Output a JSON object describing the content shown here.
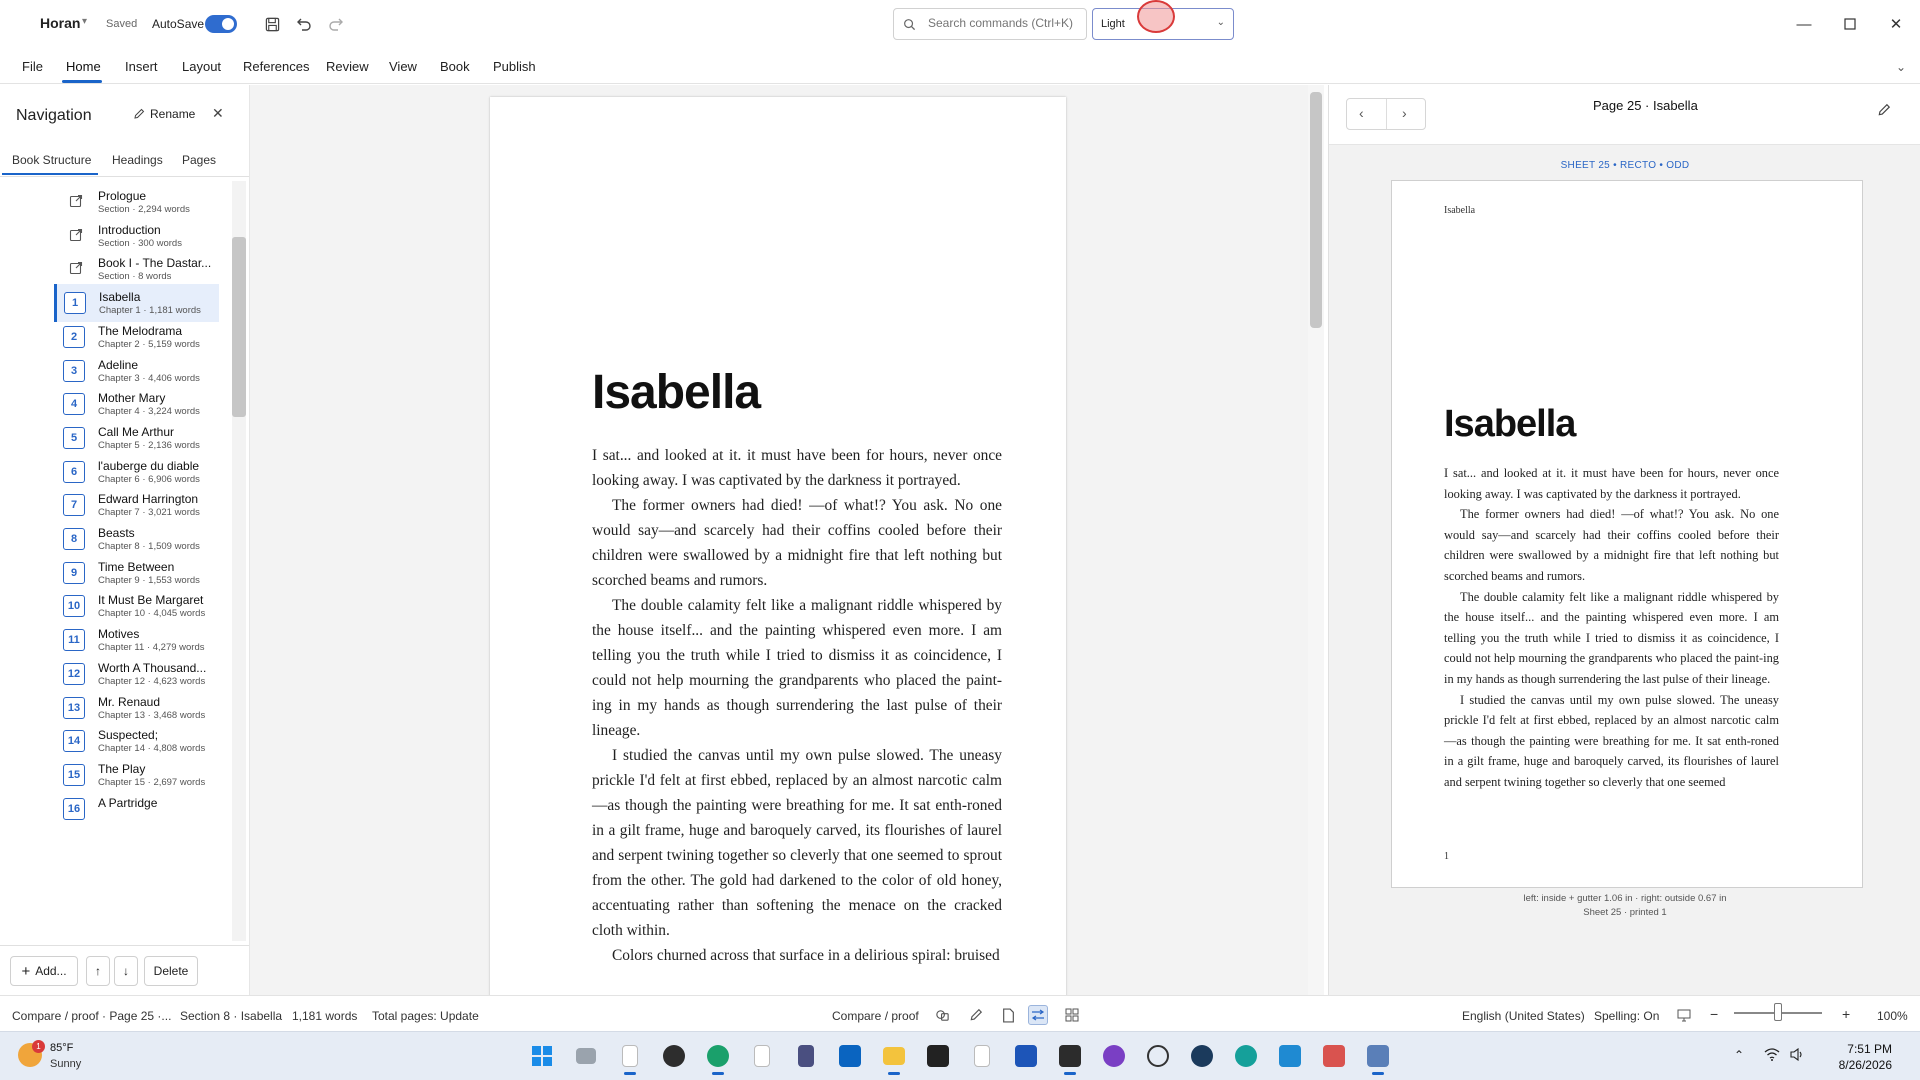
{
  "titlebar": {
    "doc_name": "Horan",
    "saved": "Saved",
    "autosave_label": "AutoSave",
    "search_placeholder": "Search commands (Ctrl+K)",
    "theme_value": "Light"
  },
  "ribbon": {
    "tabs": [
      "File",
      "Home",
      "Insert",
      "Layout",
      "References",
      "Review",
      "View",
      "Book",
      "Publish"
    ],
    "active_tab": "Home"
  },
  "nav": {
    "title": "Navigation",
    "rename": "Rename",
    "tabs": [
      "Book Structure",
      "Headings",
      "Pages"
    ],
    "items": [
      {
        "badge": "",
        "name": "Prologue",
        "meta": "Section · 2,294 words"
      },
      {
        "badge": "",
        "name": "Introduction",
        "meta": "Section · 300 words"
      },
      {
        "badge": "",
        "name": "Book I - The Dastar...",
        "meta": "Section · 8 words"
      },
      {
        "badge": "1",
        "name": "Isabella",
        "meta": "Chapter 1 · 1,181 words"
      },
      {
        "badge": "2",
        "name": "The Melodrama",
        "meta": "Chapter 2 · 5,159 words"
      },
      {
        "badge": "3",
        "name": "Adeline",
        "meta": "Chapter 3 · 4,406 words"
      },
      {
        "badge": "4",
        "name": "Mother Mary",
        "meta": "Chapter 4 · 3,224 words"
      },
      {
        "badge": "5",
        "name": "Call Me Arthur",
        "meta": "Chapter 5 · 2,136 words"
      },
      {
        "badge": "6",
        "name": "l'auberge du diable",
        "meta": "Chapter 6 · 6,906 words"
      },
      {
        "badge": "7",
        "name": "Edward Harrington",
        "meta": "Chapter 7 · 3,021 words"
      },
      {
        "badge": "8",
        "name": "Beasts",
        "meta": "Chapter 8 · 1,509 words"
      },
      {
        "badge": "9",
        "name": "Time Between",
        "meta": "Chapter 9 · 1,553 words"
      },
      {
        "badge": "10",
        "name": "It Must Be Margaret",
        "meta": "Chapter 10 · 4,045 words"
      },
      {
        "badge": "11",
        "name": "Motives",
        "meta": "Chapter 11 · 4,279 words"
      },
      {
        "badge": "12",
        "name": "Worth A Thousand...",
        "meta": "Chapter 12 · 4,623 words"
      },
      {
        "badge": "13",
        "name": "Mr. Renaud",
        "meta": "Chapter 13 · 3,468 words"
      },
      {
        "badge": "14",
        "name": "Suspected;",
        "meta": "Chapter 14 · 4,808 words"
      },
      {
        "badge": "15",
        "name": "The Play",
        "meta": "Chapter 15 · 2,697 words"
      },
      {
        "badge": "16",
        "name": "A Partridge",
        "meta": ""
      }
    ],
    "add": "Add...",
    "up": "↑",
    "down": "↓",
    "delete": "Delete"
  },
  "editor": {
    "title": "Isabella",
    "paragraphs": [
      "I sat... and looked at it. it must have been for hours,  never once looking away.  I was captivated by the darkness it portrayed.",
      "The former owners had died! —of what!? You ask.  No one would say—and scarcely had their coffins cooled before their children were swallowed by a midnight fire that left nothing but scorched beams and rumors.",
      "The double calamity felt like a malignant riddle whispered by the house itself... and the painting whispered even more. I am telling you the truth while I tried to dismiss it as coincidence, I could not help mourning the grandparents who placed the paint-ing in my hands as though surrendering the last pulse of their lineage.",
      "I studied the canvas until my own pulse slowed. The uneasy prickle I'd felt at first ebbed, replaced by an almost narcotic calm —as though the painting were breathing for me. It sat enth-roned in a gilt frame, huge and baroquely carved, its flourishes of laurel and serpent twining together so cleverly that one seemed to sprout from the other. The gold had darkened to the color of old honey, accentuating rather than softening the menace on the cracked cloth within.",
      "Colors churned across that surface in a delirious spiral: bruised"
    ]
  },
  "preview": {
    "page_label": "Page 25  ·  Isabella",
    "sheet_info": "SHEET 25  •  RECTO  •  ODD",
    "running_head": "Isabella",
    "title": "Isabella",
    "paragraphs": [
      "I sat... and looked at it. it must have been for hours,  never once looking away.  I was captivated by the darkness it portrayed.",
      "The former owners had died! —of what!? You ask.  No one would say—and scarcely had their coffins cooled before their children were swallowed by a midnight fire that left nothing but scorched beams and rumors.",
      "The double calamity felt like a malignant riddle whispered by the house itself... and the painting whispered even more. I am telling you the truth while I tried to dismiss it as coincidence, I could not help mourning the grandparents who placed the paint-ing in my hands as though surrendering the last pulse of their lineage.",
      "I studied the canvas until my own pulse slowed. The uneasy prickle I'd felt at first ebbed, replaced by an almost narcotic calm —as though the painting were breathing for me. It sat enth-roned in a gilt frame, huge and baroquely carved, its flourishes of laurel and serpent twining together so cleverly that one seemed"
    ],
    "folio": "1",
    "margins": "left: inside + gutter 1.06 in  ·  right: outside 0.67 in",
    "printed": "Sheet 25 · printed 1"
  },
  "statusbar": {
    "mode": "Compare / proof · Page 25 ·...",
    "section": "Section 8 · Isabella",
    "words": "1,181 words",
    "total_pages": "Total pages: Update",
    "view_mode": "Compare / proof",
    "language": "English (United States)",
    "spelling": "Spelling: On",
    "zoom_out": "−",
    "zoom_in": "+",
    "zoom": "100%",
    "zoom_level": 0.5
  },
  "taskbar": {
    "weather_badge": "1",
    "temperature": "85°F",
    "condition": "Sunny",
    "time": "7:51 PM",
    "date": "8/26/2026"
  },
  "icons": {
    "colors": {
      "accent": "#1a64c9",
      "autosave_on": "#2f6ccf",
      "cursor": "#d93a3a"
    }
  }
}
